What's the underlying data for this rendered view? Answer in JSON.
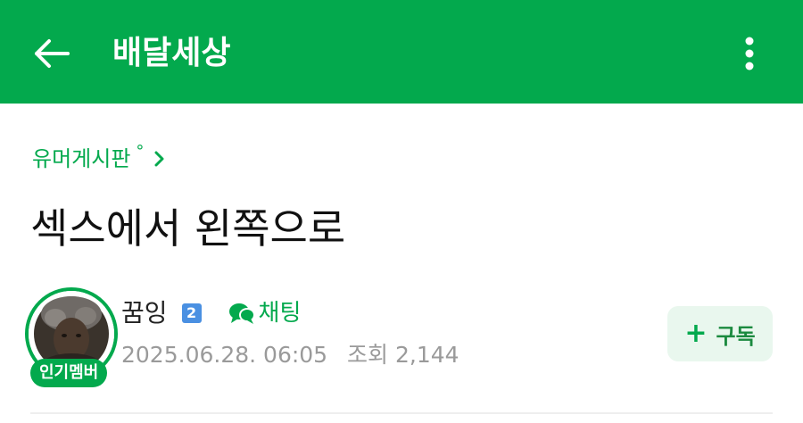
{
  "appbar": {
    "title": "배달세상",
    "back_icon": "arrow-left-icon",
    "more_icon": "more-vertical-icon",
    "color": "#03a94d"
  },
  "board": {
    "name": "유머게시판",
    "degree_mark": "°",
    "chevron_icon": "chevron-right-icon"
  },
  "post": {
    "title": "섹스에서 왼쪽으로"
  },
  "author": {
    "name": "꿈잉",
    "level": "2",
    "badge": "인기멤버",
    "chat_label": "채팅",
    "chat_icon": "chat-bubbles-icon"
  },
  "meta": {
    "datetime": "2025.06.28. 06:05",
    "views_label": "조회",
    "views": "2,144"
  },
  "subscribe": {
    "plus": "+",
    "label": "구독"
  }
}
